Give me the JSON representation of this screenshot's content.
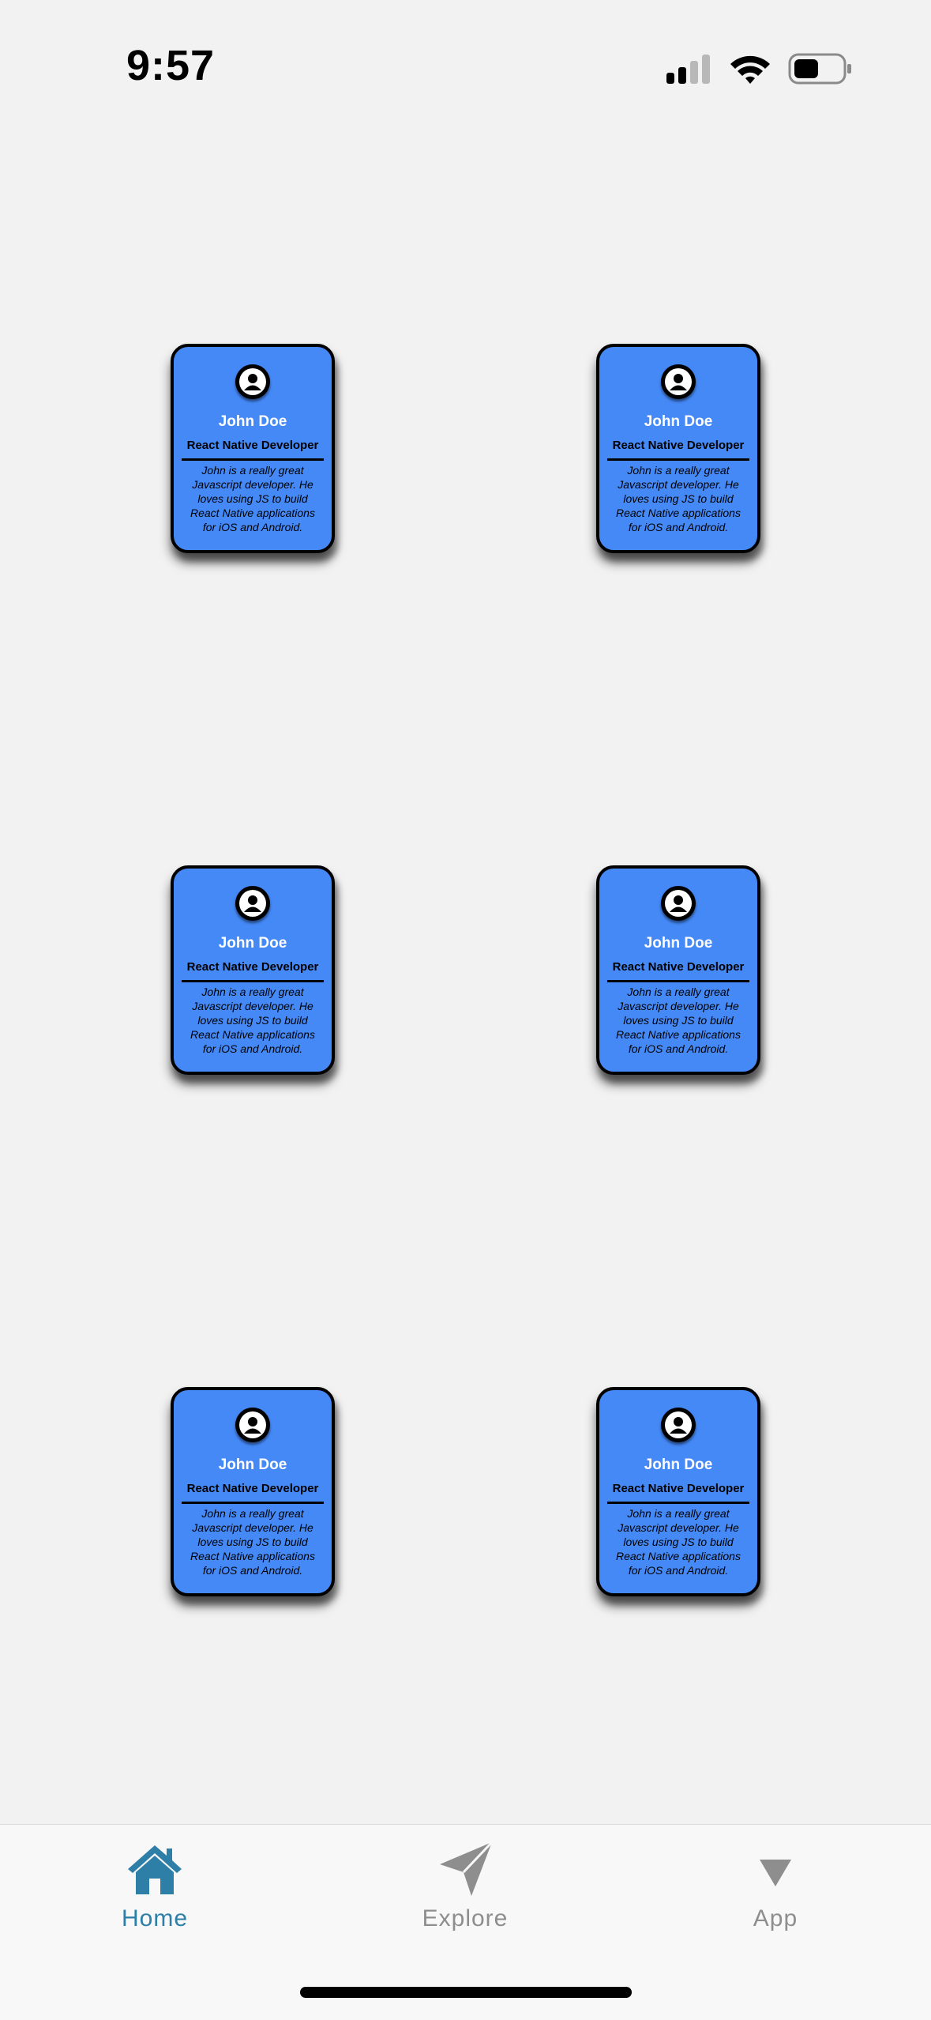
{
  "status_bar": {
    "time": "9:57"
  },
  "cards": [
    {
      "name": "John Doe",
      "role": "React Native Developer",
      "bio": "John is a really great Javascript developer. He loves using JS to build React Native applications for iOS and Android.",
      "avatar_icon": "user-icon"
    },
    {
      "name": "John Doe",
      "role": "React Native Developer",
      "bio": "John is a really great Javascript developer. He loves using JS to build React Native applications for iOS and Android.",
      "avatar_icon": "user-icon"
    },
    {
      "name": "John Doe",
      "role": "React Native Developer",
      "bio": "John is a really great Javascript developer. He loves using JS to build React Native applications for iOS and Android.",
      "avatar_icon": "user-icon"
    },
    {
      "name": "John Doe",
      "role": "React Native Developer",
      "bio": "John is a really great Javascript developer. He loves using JS to build React Native applications for iOS and Android.",
      "avatar_icon": "user-icon"
    },
    {
      "name": "John Doe",
      "role": "React Native Developer",
      "bio": "John is a really great Javascript developer. He loves using JS to build React Native applications for iOS and Android.",
      "avatar_icon": "user-icon"
    },
    {
      "name": "John Doe",
      "role": "React Native Developer",
      "bio": "John is a really great Javascript developer. He loves using JS to build React Native applications for iOS and Android.",
      "avatar_icon": "user-icon"
    }
  ],
  "tab_bar": {
    "tabs": [
      {
        "label": "Home",
        "icon": "home-icon",
        "active": true
      },
      {
        "label": "Explore",
        "icon": "paper-plane-icon",
        "active": false
      },
      {
        "label": "App",
        "icon": "triangle-down-icon",
        "active": false
      }
    ]
  },
  "colors": {
    "background": "#f2f2f2",
    "card": "#4589f7",
    "tab_active": "#2d7fa7",
    "tab_inactive": "#8e8e8e"
  }
}
